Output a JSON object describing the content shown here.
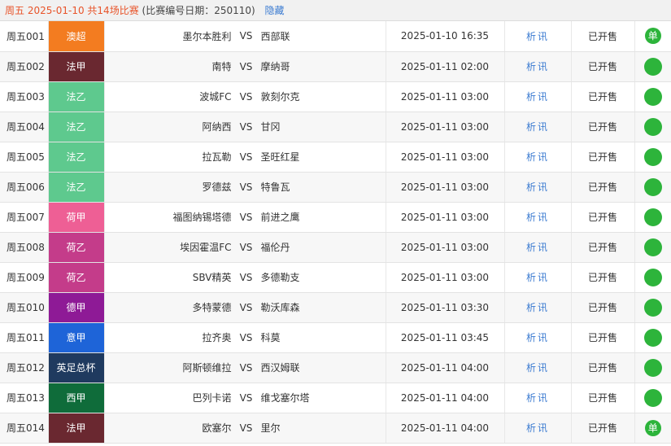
{
  "header": {
    "day": "周五",
    "date": "2025-01-10",
    "count_text": "共14场比赛",
    "meta": "(比赛编号日期：250110)",
    "hide_label": "隐藏"
  },
  "vs_label": "VS",
  "matches": [
    {
      "id": "周五001",
      "league": "澳超",
      "league_color": "#f37c20",
      "home": "墨尔本胜利",
      "away": "西部联",
      "time": "2025-01-10 16:35",
      "info": "析讯",
      "status": "已开售",
      "badge": "单"
    },
    {
      "id": "周五002",
      "league": "法甲",
      "league_color": "#6a2830",
      "home": "南特",
      "away": "摩纳哥",
      "time": "2025-01-11 02:00",
      "info": "析讯",
      "status": "已开售",
      "badge": ""
    },
    {
      "id": "周五003",
      "league": "法乙",
      "league_color": "#5ec98e",
      "home": "波城FC",
      "away": "敦刻尔克",
      "time": "2025-01-11 03:00",
      "info": "析讯",
      "status": "已开售",
      "badge": ""
    },
    {
      "id": "周五004",
      "league": "法乙",
      "league_color": "#5ec98e",
      "home": "阿纳西",
      "away": "甘冈",
      "time": "2025-01-11 03:00",
      "info": "析讯",
      "status": "已开售",
      "badge": ""
    },
    {
      "id": "周五005",
      "league": "法乙",
      "league_color": "#5ec98e",
      "home": "拉瓦勒",
      "away": "圣旺红星",
      "time": "2025-01-11 03:00",
      "info": "析讯",
      "status": "已开售",
      "badge": ""
    },
    {
      "id": "周五006",
      "league": "法乙",
      "league_color": "#5ec98e",
      "home": "罗德兹",
      "away": "特鲁瓦",
      "time": "2025-01-11 03:00",
      "info": "析讯",
      "status": "已开售",
      "badge": ""
    },
    {
      "id": "周五007",
      "league": "荷甲",
      "league_color": "#ee5f95",
      "home": "福图纳锡塔德",
      "away": "前进之鹰",
      "time": "2025-01-11 03:00",
      "info": "析讯",
      "status": "已开售",
      "badge": ""
    },
    {
      "id": "周五008",
      "league": "荷乙",
      "league_color": "#c43c8a",
      "home": "埃因霍温FC",
      "away": "福伦丹",
      "time": "2025-01-11 03:00",
      "info": "析讯",
      "status": "已开售",
      "badge": ""
    },
    {
      "id": "周五009",
      "league": "荷乙",
      "league_color": "#c43c8a",
      "home": "SBV精英",
      "away": "多德勒支",
      "time": "2025-01-11 03:00",
      "info": "析讯",
      "status": "已开售",
      "badge": ""
    },
    {
      "id": "周五010",
      "league": "德甲",
      "league_color": "#8e1a96",
      "home": "多特蒙德",
      "away": "勒沃库森",
      "time": "2025-01-11 03:30",
      "info": "析讯",
      "status": "已开售",
      "badge": ""
    },
    {
      "id": "周五011",
      "league": "意甲",
      "league_color": "#1e64d8",
      "home": "拉齐奥",
      "away": "科莫",
      "time": "2025-01-11 03:45",
      "info": "析讯",
      "status": "已开售",
      "badge": ""
    },
    {
      "id": "周五012",
      "league": "英足总杯",
      "league_color": "#1f3a5f",
      "home": "阿斯顿维拉",
      "away": "西汉姆联",
      "time": "2025-01-11 04:00",
      "info": "析讯",
      "status": "已开售",
      "badge": ""
    },
    {
      "id": "周五013",
      "league": "西甲",
      "league_color": "#0f6c3a",
      "home": "巴列卡诺",
      "away": "维戈塞尔塔",
      "time": "2025-01-11 04:00",
      "info": "析讯",
      "status": "已开售",
      "badge": ""
    },
    {
      "id": "周五014",
      "league": "法甲",
      "league_color": "#6a2830",
      "home": "欧塞尔",
      "away": "里尔",
      "time": "2025-01-11 04:00",
      "info": "析讯",
      "status": "已开售",
      "badge": "单"
    }
  ]
}
